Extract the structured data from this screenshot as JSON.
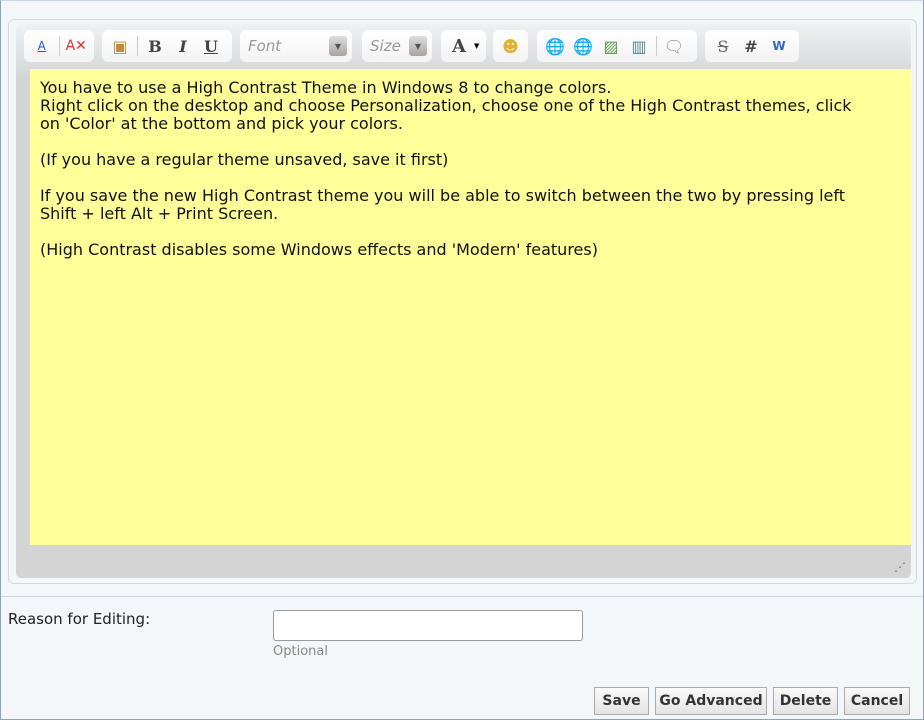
{
  "toolbar": {
    "font_placeholder": "Font",
    "size_placeholder": "Size",
    "bold": "B",
    "italic": "I",
    "underline": "U",
    "text_color": "A",
    "strike": "S",
    "hash": "#"
  },
  "editor": {
    "background_color": "#ffff99",
    "content": "You have to use a High Contrast Theme in Windows 8 to change colors.\nRight click on the desktop and choose Personalization, choose one of the High Contrast themes, click\non 'Color' at the bottom and pick your colors.\n\n(If you have a regular theme unsaved, save it first)\n\nIf you save the new High Contrast theme you will be able to switch between the two by pressing left\nShift + left Alt + Print Screen.\n\n(High Contrast disables some Windows effects and 'Modern' features)"
  },
  "reason": {
    "label": "Reason for Editing:",
    "value": "",
    "hint": "Optional"
  },
  "buttons": {
    "save": "Save",
    "go_advanced": "Go Advanced",
    "delete": "Delete",
    "cancel": "Cancel"
  }
}
